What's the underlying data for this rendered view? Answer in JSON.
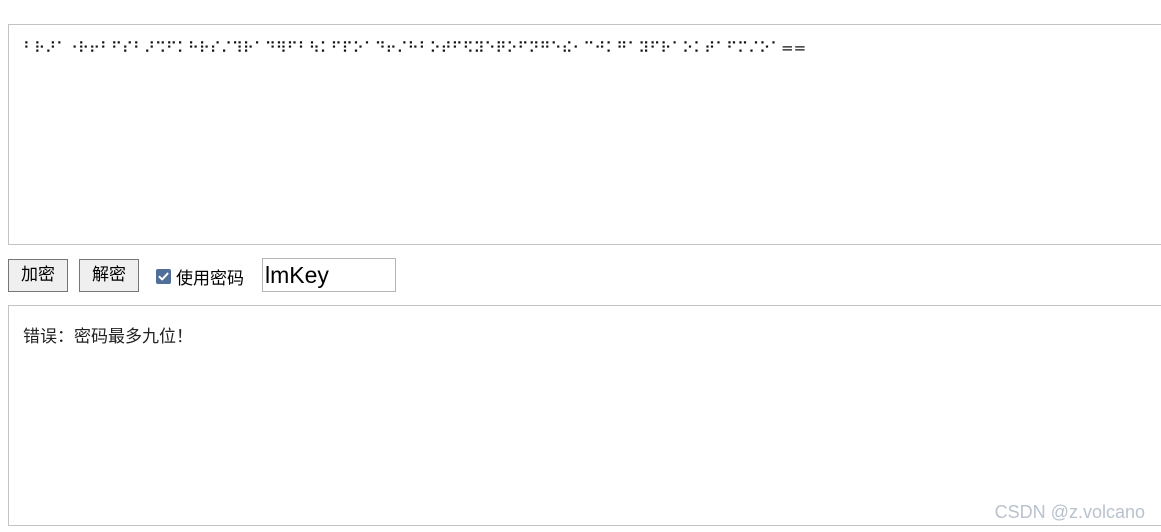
{
  "encoder": {
    "input_text": "⠃⠗⠜⠁⠐⠗⠖⠃⠋⠎⠃⠜⠩⠋⠅⠓⠗⠎⠌⠹⠗⠁⠙⠻⠋⠃⠳⠅⠋⠏⠕⠁⠙⠖⠌⠓⠃⠕⠞⠋⠫⠽⠑⠟⠕⠋⠝⠛⠑⠮⠂⠉⠚⠅⠛⠁⠽⠋⠗⠁⠕⠅⠞⠁⠋⠍⠌⠕⠁==",
    "encrypt_label": "加密",
    "decrypt_label": "解密",
    "use_password_label": "使用密码",
    "use_password_checked": true,
    "password_value": "lmKey",
    "output_text": "错误：密码最多九位！"
  },
  "watermark": "CSDN @z.volcano",
  "colors": {
    "checkbox_accent": "#4f6f9a",
    "border": "#c3c3c3",
    "watermark": "#b9c2cc"
  }
}
